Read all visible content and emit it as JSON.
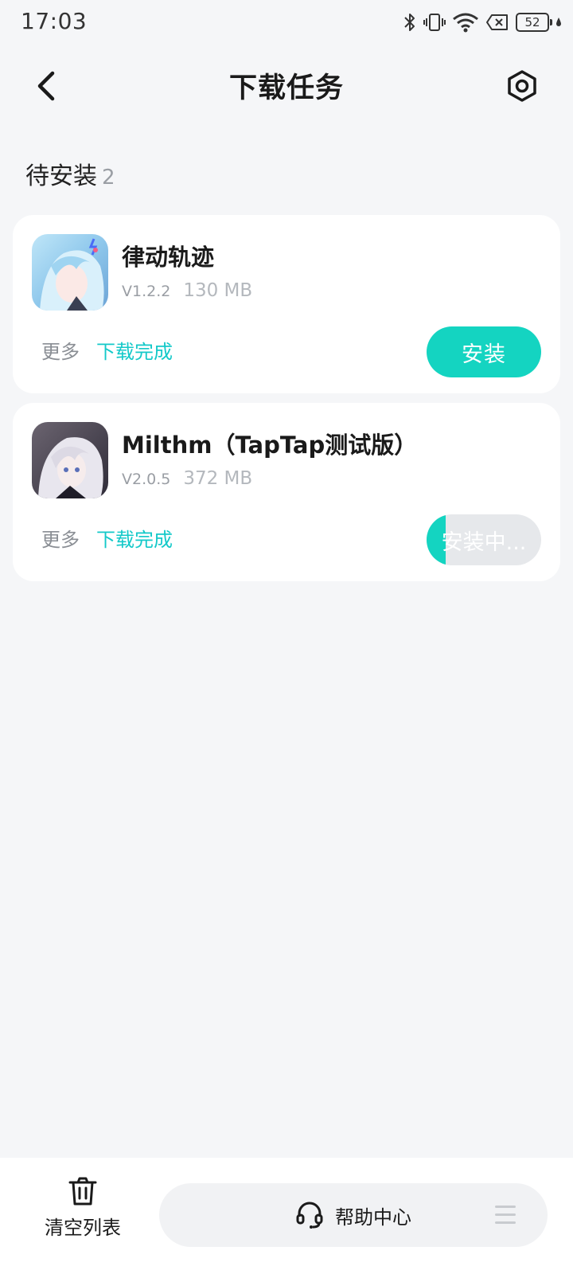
{
  "status_bar": {
    "time": "17:03",
    "battery": "52"
  },
  "header": {
    "title": "下载任务"
  },
  "section": {
    "title": "待安装",
    "count": "2"
  },
  "tasks": [
    {
      "name": "律动轨迹",
      "version": "V1.2.2",
      "size": "130 MB",
      "more": "更多",
      "status": "下载完成",
      "action": "安装"
    },
    {
      "name": "Milthm（TapTap测试版）",
      "version": "V2.0.5",
      "size": "372 MB",
      "more": "更多",
      "status": "下载完成",
      "action": "安装中...",
      "install_progress": 0.17
    }
  ],
  "bottom_bar": {
    "clear_label": "清空列表",
    "help_label": "帮助中心"
  },
  "icons": {
    "back": "chevron-left-icon",
    "settings": "hexagon-settings-icon",
    "clear": "trash-icon",
    "help": "headset-icon",
    "menu": "menu-icon"
  },
  "colors": {
    "accent": "#14d4c1",
    "status_text": "#14c9c9",
    "background": "#f5f6f8"
  }
}
